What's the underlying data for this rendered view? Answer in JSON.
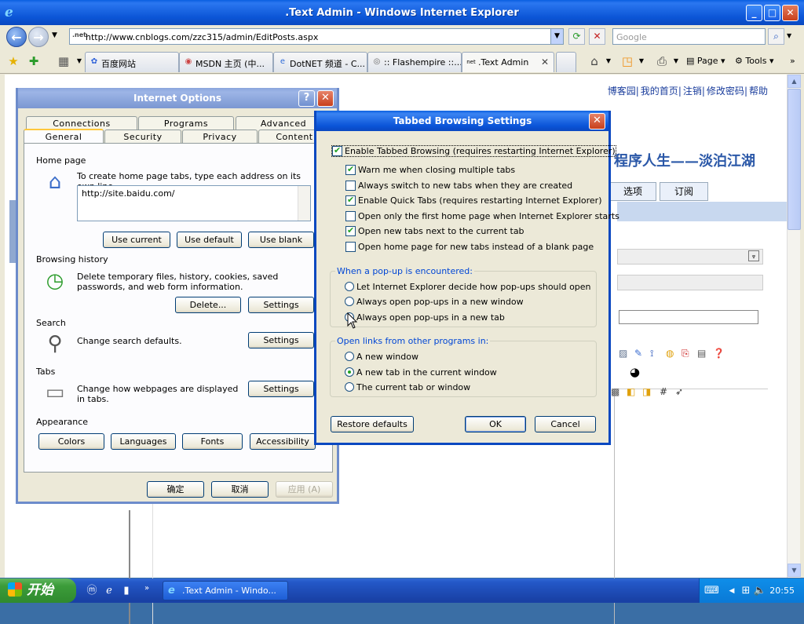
{
  "ie": {
    "window_title": ".Text Admin - Windows Internet Explorer",
    "url_prefix": ".net",
    "url": "http://www.cnblogs.com/zzc315/admin/EditPosts.aspx",
    "search_placeholder": "Google",
    "tabs": [
      {
        "label": "百度网站"
      },
      {
        "label": "MSDN 主页 (中..."
      },
      {
        "label": "DotNET 频道 - C..."
      },
      {
        "label": ":: Flashempire ::..."
      },
      {
        "label": ".Text Admin"
      }
    ],
    "commands": {
      "page": "Page",
      "tools": "Tools"
    }
  },
  "blog": {
    "top_links": [
      "博客园",
      "我的首页",
      "注销",
      "修改密码",
      "帮助"
    ],
    "title": "程序人生——淡泊江湖",
    "nav_tabs": [
      "选项",
      "订阅"
    ]
  },
  "internet_options": {
    "title": "Internet Options",
    "tabs_row1": [
      "Connections",
      "Programs",
      "Advanced"
    ],
    "tabs_row2": [
      "General",
      "Security",
      "Privacy",
      "Content"
    ],
    "home_page": {
      "label": "Home page",
      "desc": "To create home page tabs, type each address on its own line.",
      "value": "http://site.baidu.com/",
      "buttons": [
        "Use current",
        "Use default",
        "Use blank"
      ]
    },
    "browsing_history": {
      "label": "Browsing history",
      "desc": "Delete temporary files, history, cookies, saved passwords, and web form information.",
      "delete": "Delete...",
      "settings": "Settings"
    },
    "search": {
      "label": "Search",
      "desc": "Change search defaults.",
      "settings": "Settings"
    },
    "tabs_section": {
      "label": "Tabs",
      "desc": "Change how webpages are displayed in tabs.",
      "settings": "Settings"
    },
    "appearance": {
      "label": "Appearance",
      "buttons": [
        "Colors",
        "Languages",
        "Fonts",
        "Accessibility"
      ]
    },
    "footer": {
      "ok": "确定",
      "cancel": "取消",
      "apply": "应用 (A)"
    }
  },
  "tabbed_settings": {
    "title": "Tabbed Browsing Settings",
    "enable_tabbed": "Enable Tabbed Browsing (requires restarting Internet Explorer)",
    "options": [
      {
        "label": "Warn me when closing multiple tabs",
        "checked": true
      },
      {
        "label": "Always switch to new tabs when they are created",
        "checked": false
      },
      {
        "label": "Enable Quick Tabs (requires restarting Internet Explorer)",
        "checked": true
      },
      {
        "label": "Open only the first home page when Internet Explorer starts",
        "checked": false
      },
      {
        "label": "Open new tabs next to the current tab",
        "checked": true
      },
      {
        "label": "Open home page for new tabs instead of a blank page",
        "checked": false
      }
    ],
    "popup_group": {
      "title": "When a pop-up is encountered:",
      "choices": [
        {
          "label": "Let Internet Explorer decide how pop-ups should open",
          "selected": false
        },
        {
          "label": "Always open pop-ups in a new window",
          "selected": false
        },
        {
          "label": "Always open pop-ups in a new tab",
          "selected": true
        }
      ]
    },
    "links_group": {
      "title": "Open links from other programs in:",
      "choices": [
        {
          "label": "A new window",
          "selected": false
        },
        {
          "label": "A new tab in the current window",
          "selected": true
        },
        {
          "label": "The current tab or window",
          "selected": false
        }
      ]
    },
    "restore": "Restore defaults",
    "ok": "OK",
    "cancel": "Cancel"
  },
  "taskbar": {
    "start": "开始",
    "task": ".Text Admin - Windo...",
    "time": "20:55"
  }
}
